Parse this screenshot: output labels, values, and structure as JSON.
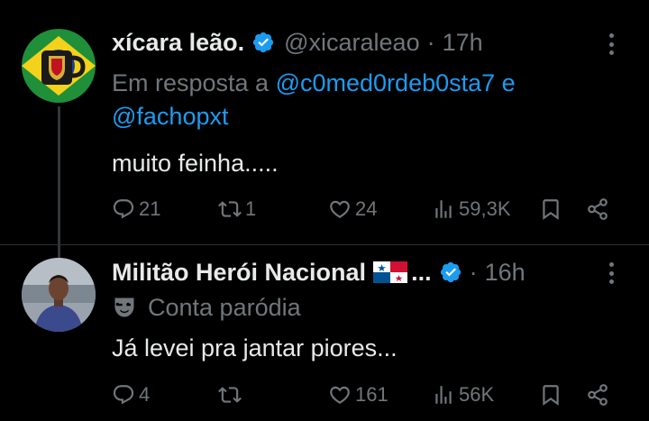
{
  "tweets": [
    {
      "name": "xícara leão.",
      "handle": "@xicaraleao",
      "separator": "·",
      "time": "17h",
      "reply_prefix": "Em resposta a",
      "reply_mentions": [
        "@c0med0rdeb0sta7",
        "@fachopxt"
      ],
      "reply_joiner": "e",
      "text": "muito feinha.....",
      "actions": {
        "replies": "21",
        "reposts": "1",
        "likes": "24",
        "views": "59,3K"
      }
    },
    {
      "name": "Militão Herói Nacional",
      "name_suffix": "...",
      "handle": "",
      "separator": "·",
      "time": "16h",
      "parody_label": "Conta paródia",
      "text": "Já levei pra jantar piores...",
      "actions": {
        "replies": "4",
        "reposts": "",
        "likes": "161",
        "views": "56K"
      }
    }
  ],
  "colors": {
    "background": "#000000",
    "text": "#e7e9ea",
    "secondary": "#71767b",
    "accent": "#1d9bf0"
  },
  "icons": [
    "verified-badge-icon",
    "more-options-icon",
    "reply-icon",
    "repost-icon",
    "like-icon",
    "views-icon",
    "bookmark-icon",
    "share-icon",
    "parody-mask-icon",
    "panama-flag-icon"
  ]
}
